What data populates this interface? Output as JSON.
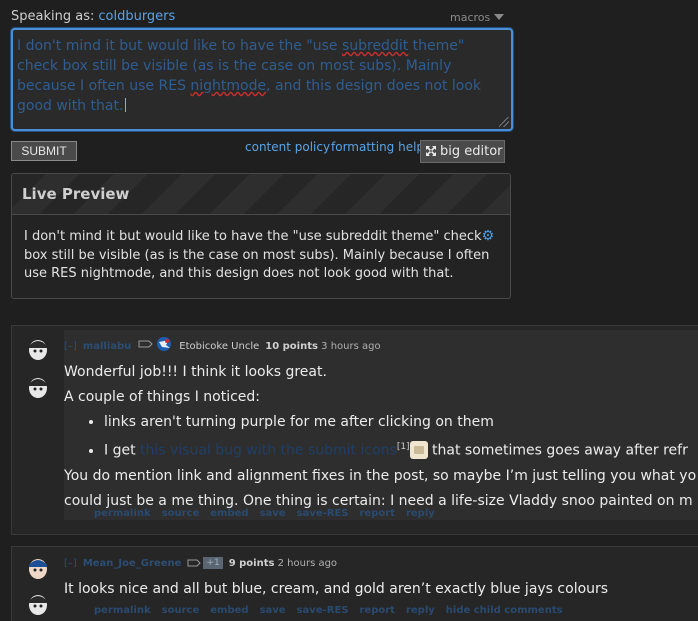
{
  "reply": {
    "speaking_label": "Speaking as:",
    "username": "coldburgers",
    "macros_label": "macros",
    "text_part1": "I don't mind it but would like to have the \"use ",
    "text_spell1": "subreddit",
    "text_part2": " theme\" check box still be visible (as is the case on most subs). Mainly because I often use RES ",
    "text_spell2": "nightmode",
    "text_part3": ", and this design does not look good with that.",
    "submit_label": "SUBMIT",
    "content_policy": "content policy",
    "formatting_help": "formatting help",
    "big_editor": "big editor"
  },
  "preview": {
    "title": "Live Preview",
    "line1": "I don't mind it but would like to have the \"use subreddit theme\" check",
    "line2": "box still be visible (as is the case on most subs). Mainly because I often",
    "line3": "use RES nightmode, and this design does not look good with that."
  },
  "comments": [
    {
      "toggle": "[–]",
      "author": "malliabu",
      "flair": "Etobicoke Uncle",
      "score": "10 points",
      "time": "3 hours ago",
      "p1": "Wonderful job!!! I think it looks great.",
      "p2": "A couple of things I noticed:",
      "li1": "links aren't turning purple for me after clicking on them",
      "li2_pre": "I get ",
      "li2_link": "this visual bug with the submit icons",
      "li2_sup": "[1]",
      "li2_post": " that sometimes goes away after refr",
      "p3a": "You do mention link and alignment fixes in the post, so maybe I’m just telling you what yo",
      "p3b": "could just be a me thing. One thing is certain: I need a life-size Vladdy snoo painted on m",
      "buttons": [
        "permalink",
        "source",
        "embed",
        "save",
        "save-RES",
        "report",
        "reply"
      ]
    },
    {
      "toggle": "[–]",
      "author": "Mean_Joe_Greene",
      "badge": "+1",
      "score": "9 points",
      "time": "2 hours ago",
      "p1": "It looks nice and all but blue, cream, and gold aren’t exactly blue jays colours",
      "buttons": [
        "permalink",
        "source",
        "embed",
        "save",
        "save-RES",
        "report",
        "reply",
        "hide child comments"
      ]
    }
  ],
  "colors": {
    "link": "#5aa3e6",
    "editor_border": "#4a8fd6",
    "background": "#1f1f1f"
  }
}
